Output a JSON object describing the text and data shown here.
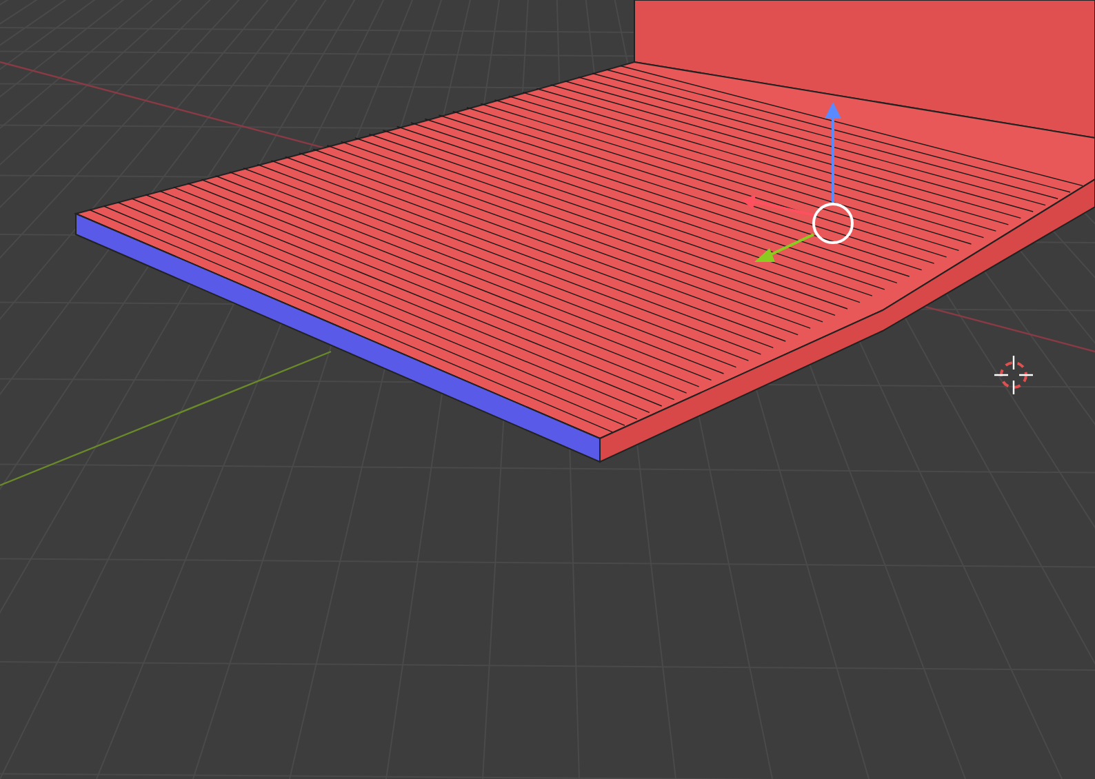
{
  "viewport": {
    "gizmo": true,
    "cursor_3d": true
  }
}
